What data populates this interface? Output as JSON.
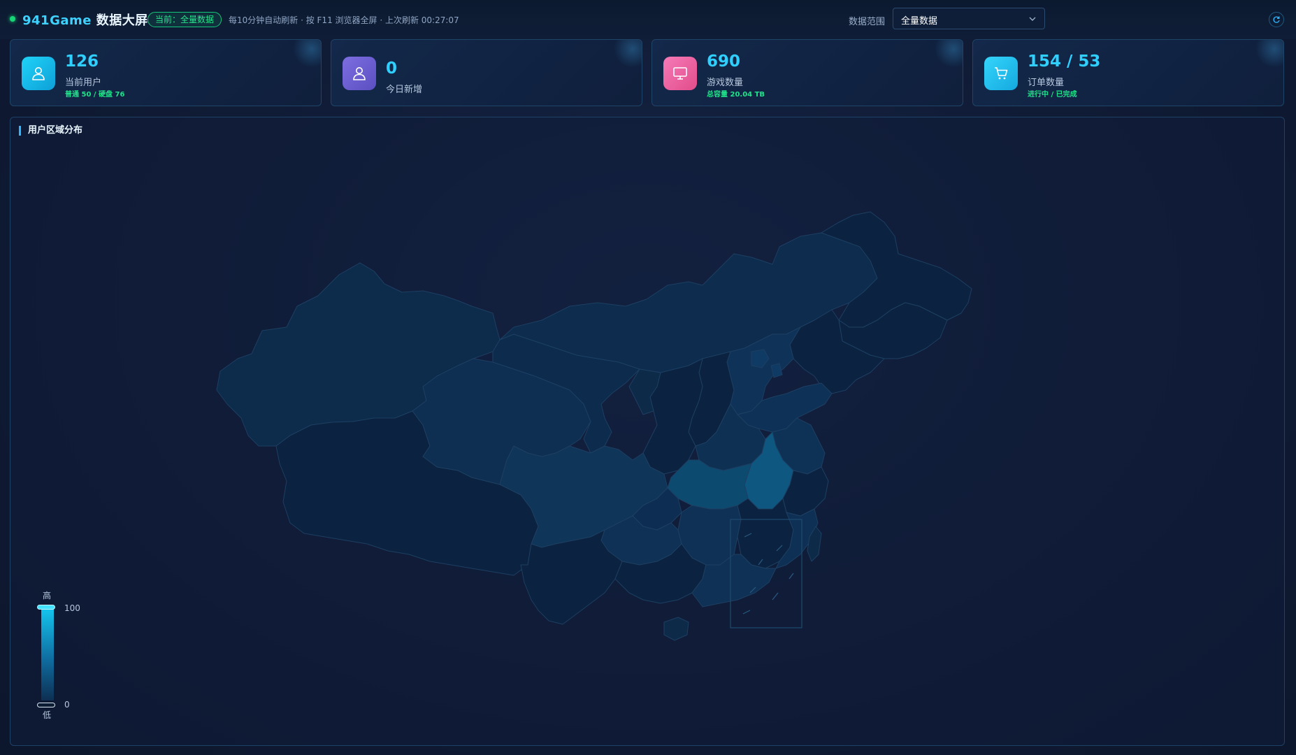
{
  "header": {
    "title_prefix": "941Game",
    "title_suffix": "数据大屏",
    "scope_badge": "当前：全量数据",
    "refresh_info": "每10分钟自动刷新 · 按 F11 浏览器全屏 · 上次刷新 00:27:07",
    "range_label": "数据范围",
    "range_value": "全量数据"
  },
  "cards": [
    {
      "value": "126",
      "label": "当前用户",
      "sub": "普通 50 / 硬盘 76",
      "icon": "user-icon",
      "color": "#16b7e9"
    },
    {
      "value": "0",
      "label": "今日新增",
      "sub": "",
      "icon": "user-icon",
      "color": "#6b5fd0"
    },
    {
      "value": "690",
      "label": "游戏数量",
      "sub": "总容量 20.04 TB",
      "icon": "monitor-icon",
      "color": "#ef5ba0"
    },
    {
      "value": "154 / 53",
      "label": "订单数量",
      "sub": "进行中 / 已完成",
      "icon": "cart-icon",
      "color": "#1ec8f5"
    }
  ],
  "map_panel": {
    "title": "用户区域分布",
    "legend": {
      "high": "高",
      "low": "低",
      "max": "100",
      "min": "0"
    }
  },
  "colors": {
    "accent": "#2fd0ff",
    "success": "#1fe38a",
    "map_low": "#0d2240",
    "map_high": "#0e5e8a"
  }
}
